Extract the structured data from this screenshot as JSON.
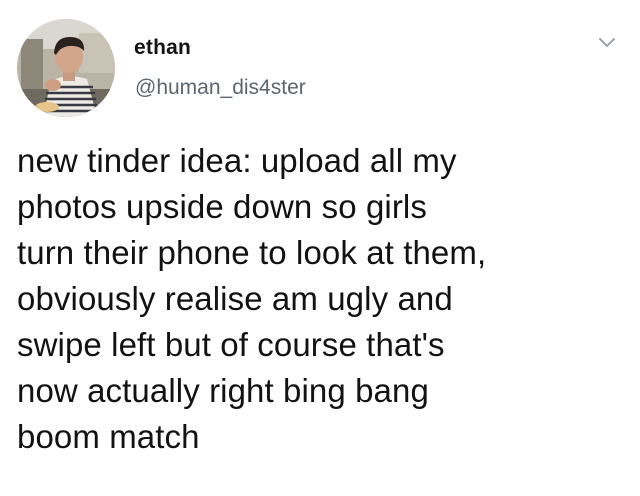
{
  "author": {
    "name": "ethan",
    "handle": "@human_dis4ster"
  },
  "icons": {
    "menu": "chevron-down-icon",
    "avatar": "profile-photo"
  },
  "tweet": {
    "text": "new tinder idea: upload all my\nphotos upside down so girls\nturn their phone to look at them,\nobviously realise am ugly and\nswipe left but of course that's\nnow actually right bing bang\nboom match"
  },
  "colors": {
    "text": "#121212",
    "handle": "#5b6670",
    "background": "#ffffff",
    "chevron": "#9aa3ab"
  }
}
